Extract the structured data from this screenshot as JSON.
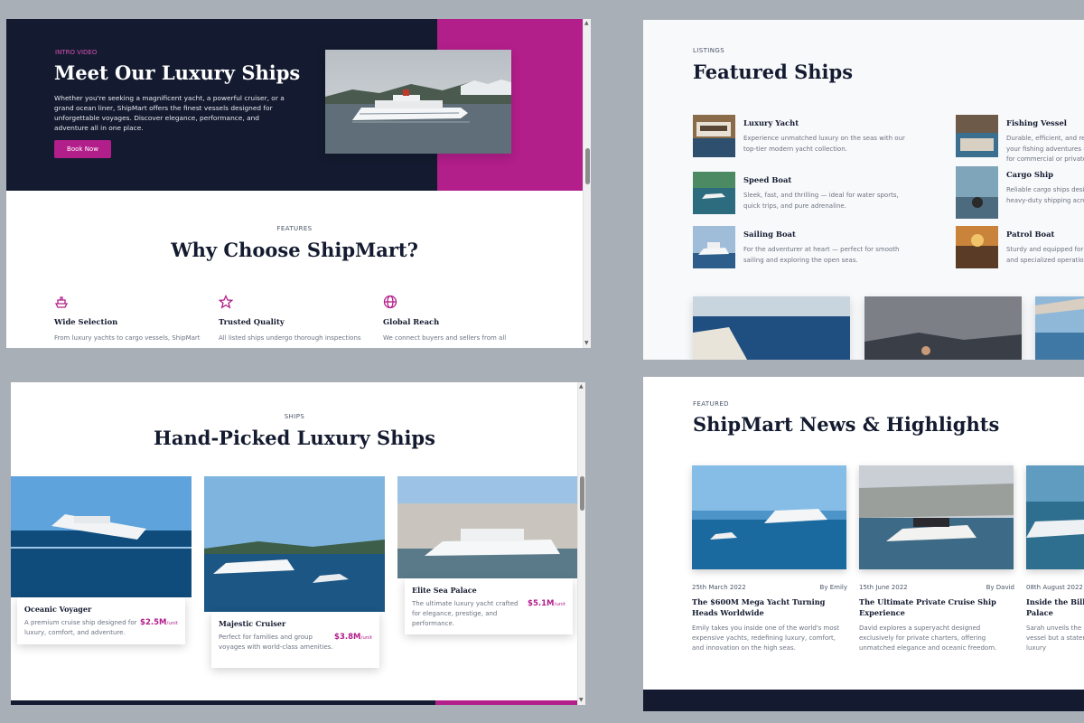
{
  "hero": {
    "kicker": "INTRO VIDEO",
    "title": "Meet Our Luxury Ships",
    "text": "Whether you're seeking a magnificent yacht, a powerful cruiser, or a grand ocean liner, ShipMart offers the finest vessels designed for unforgettable voyages. Discover elegance, performance, and adventure all in one place.",
    "button": "Book Now"
  },
  "features": {
    "kicker": "FEATURES",
    "title": "Why Choose ShipMart?",
    "items": [
      {
        "icon": "ship-icon",
        "title": "Wide Selection",
        "desc": "From luxury yachts to cargo vessels, ShipMart"
      },
      {
        "icon": "star-icon",
        "title": "Trusted Quality",
        "desc": "All listed ships undergo thorough inspections"
      },
      {
        "icon": "globe-icon",
        "title": "Global Reach",
        "desc": "We connect buyers and sellers from all"
      }
    ]
  },
  "listings": {
    "kicker": "LISTINGS",
    "title": "Featured Ships",
    "items": [
      {
        "name": "Luxury Yacht",
        "desc": "Experience unmatched luxury on the seas with our top-tier modern yacht collection."
      },
      {
        "name": "Speed Boat",
        "desc": "Sleek, fast, and thrilling — ideal for water sports, quick trips, and pure adrenaline."
      },
      {
        "name": "Sailing Boat",
        "desc": "For the adventurer at heart — perfect for smooth sailing and exploring the open seas."
      },
      {
        "name": "Fishing Vessel",
        "desc": "Durable, efficient, and ready for your fishing adventures — perfect for commercial or private fishing."
      },
      {
        "name": "Cargo Ship",
        "desc": "Reliable cargo ships designed for heavy-duty shipping across oceans."
      },
      {
        "name": "Patrol Boat",
        "desc": "Sturdy and equipped for security and specialized operations at sea."
      }
    ]
  },
  "ships": {
    "kicker": "SHIPS",
    "title": "Hand-Picked Luxury Ships",
    "items": [
      {
        "name": "Oceanic Voyager",
        "desc": "A premium cruise ship designed for luxury, comfort, and adventure.",
        "price": "$2.5M",
        "unit": "/unit"
      },
      {
        "name": "Majestic Cruiser",
        "desc": "Perfect for families and group voyages with world-class amenities.",
        "price": "$3.8M",
        "unit": "/unit"
      },
      {
        "name": "Elite Sea Palace",
        "desc": "The ultimate luxury yacht crafted for elegance, prestige, and performance.",
        "price": "$5.1M",
        "unit": "/unit"
      }
    ]
  },
  "news": {
    "kicker": "FEATURED",
    "title": "ShipMart News & Highlights",
    "items": [
      {
        "date": "25th March 2022",
        "author": "By Emily",
        "title": "The $600M Mega Yacht Turning Heads Worldwide",
        "desc": "Emily takes you inside one of the world's most expensive yachts, redefining luxury, comfort, and innovation on the high seas."
      },
      {
        "date": "15th June 2022",
        "author": "By David",
        "title": "The Ultimate Private Cruise Ship Experience",
        "desc": "David explores a superyacht designed exclusively for private charters, offering unmatched elegance and oceanic freedom."
      },
      {
        "date": "08th August 2022",
        "author": "",
        "title": "Inside the Billionaire's Floating Palace",
        "desc": "Sarah unveils the luxury floating palace — just a vessel but a statement, breaking records for luxury"
      }
    ]
  },
  "colors": {
    "navy": "#141b30",
    "magenta": "#b21e8a",
    "background": "#a9afb6"
  }
}
